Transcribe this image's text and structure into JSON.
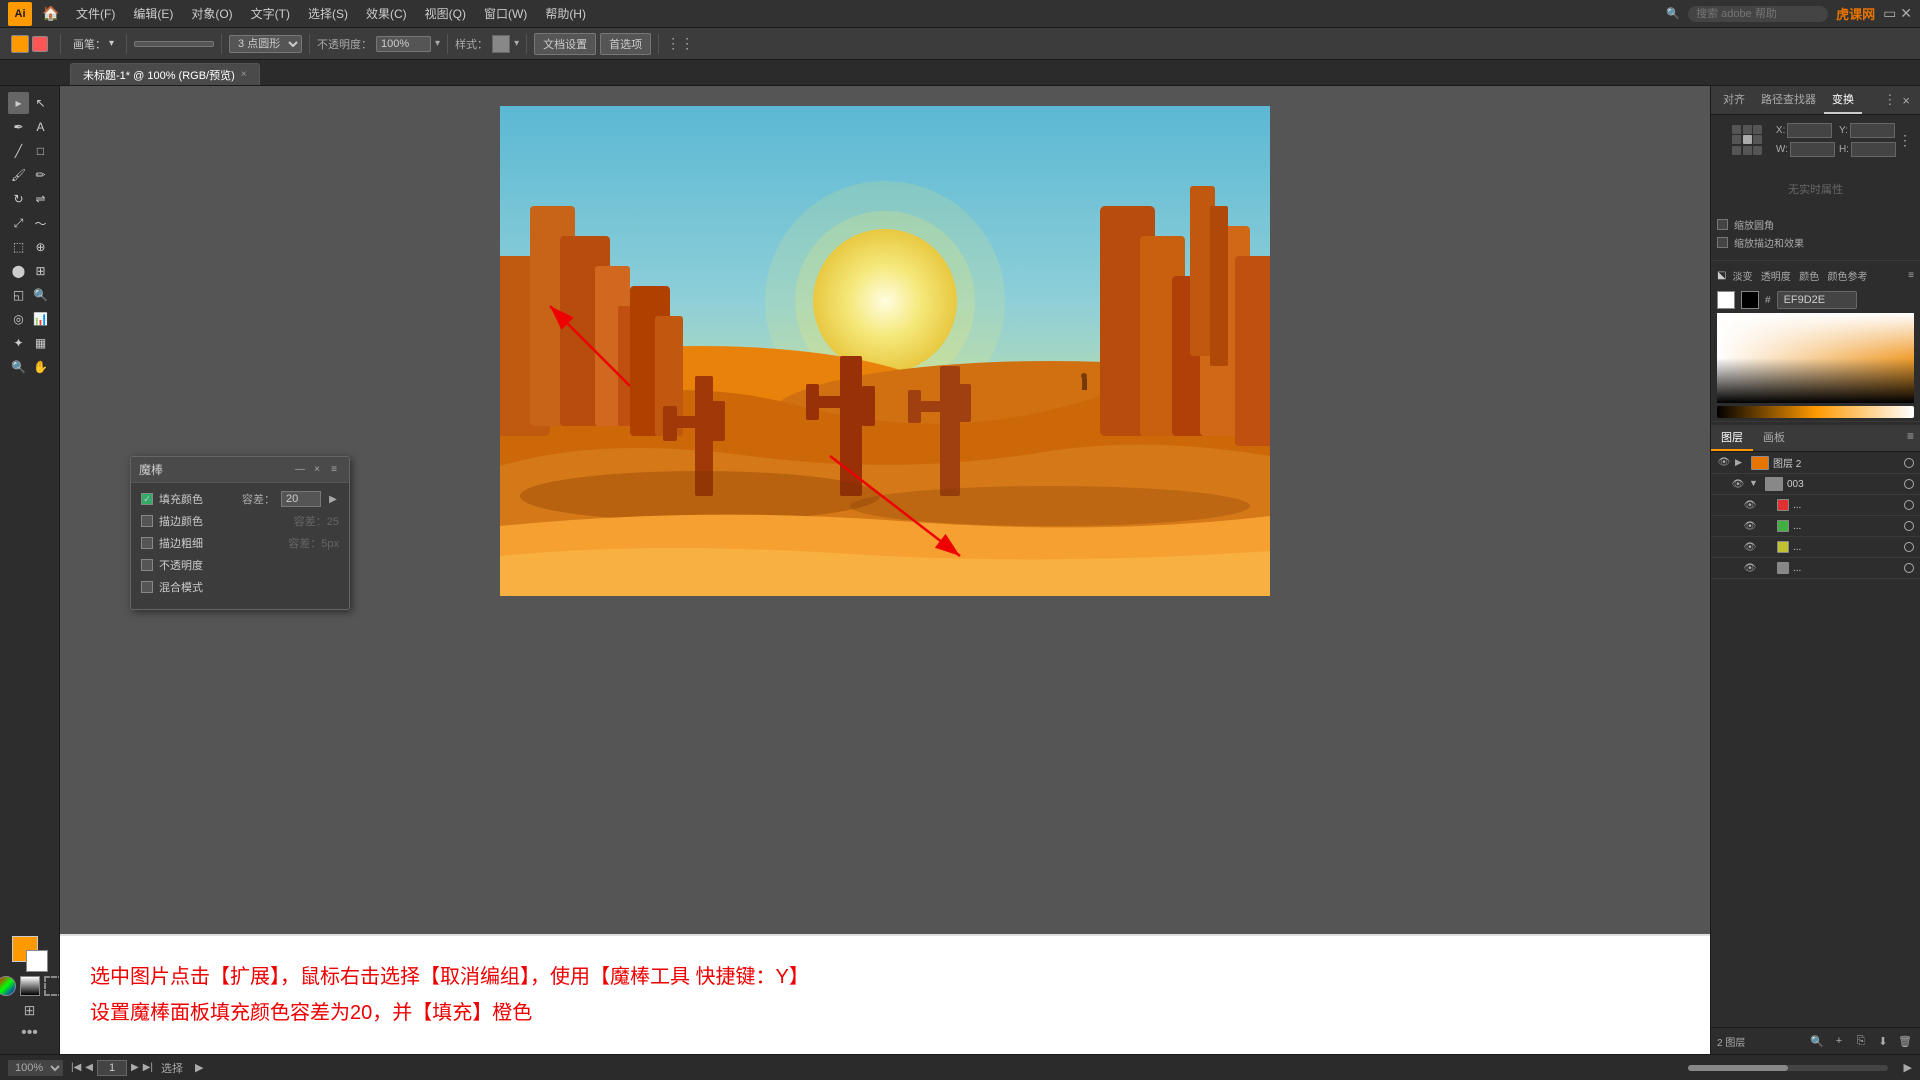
{
  "app": {
    "title": "Adobe Illustrator",
    "logo": "Ai"
  },
  "menu": {
    "items": [
      "文件(F)",
      "编辑(E)",
      "对象(O)",
      "文字(T)",
      "选择(S)",
      "效果(C)",
      "视图(Q)",
      "窗口(W)",
      "帮助(H)"
    ],
    "search_placeholder": "搜索 adobe 帮助",
    "watermark": "虎课网"
  },
  "toolbar": {
    "stroke_label": "描边：",
    "brush_label": "画笔：",
    "point_label": "3 点圆形",
    "opacity_label": "不透明度：",
    "opacity_value": "100%",
    "style_label": "样式：",
    "doc_settings": "文档设置",
    "preferences": "首选项"
  },
  "tab": {
    "title": "未标题-1* @ 100% (RGB/预览)",
    "close": "×"
  },
  "magic_panel": {
    "title": "魔棒",
    "options": [
      {
        "label": "填充颜色",
        "checked": true,
        "has_value": true,
        "value": "20"
      },
      {
        "label": "描边颜色",
        "checked": false,
        "has_value": false,
        "value": "容差：25"
      },
      {
        "label": "描边粗细",
        "checked": false,
        "has_value": false,
        "value": "容差：5px"
      },
      {
        "label": "不透明度",
        "checked": false,
        "has_value": false,
        "value": ""
      },
      {
        "label": "混合模式",
        "checked": false,
        "has_value": false,
        "value": ""
      }
    ],
    "tolerance_label": "容差：",
    "tolerance_value": "20"
  },
  "instruction": {
    "line1": "选中图片点击【扩展】，鼠标右击选择【取消编组】，使用【魔棒工具 快捷键：Y】",
    "line2": "设置魔棒面板填充颜色容差为20，并【填充】橙色"
  },
  "right_panel": {
    "tabs": [
      "对齐",
      "路径查找器",
      "变换"
    ],
    "active_tab": "变换",
    "no_attr": "无实时属性",
    "checkboxes": [
      "缩放圆角",
      "缩放描边和效果"
    ],
    "rows": [
      {
        "label": "淡变",
        "value": ""
      },
      {
        "label": "透明度",
        "value": ""
      },
      {
        "label": "颜色",
        "value": ""
      },
      {
        "label": "颜色参考",
        "value": ""
      }
    ],
    "hex_value": "EF9D2E"
  },
  "layers_panel": {
    "tabs": [
      "图层",
      "画板"
    ],
    "active_tab": "图层",
    "layers": [
      {
        "name": "图层 2",
        "level": 0,
        "expanded": true,
        "has_eye": true,
        "has_expand": true
      },
      {
        "name": "003",
        "level": 1,
        "expanded": false,
        "has_eye": true
      },
      {
        "name": "...",
        "level": 2,
        "color": "#e03030"
      },
      {
        "name": "...",
        "level": 2,
        "color": "#40b040"
      },
      {
        "name": "...",
        "level": 2,
        "color": "#c0c030"
      },
      {
        "name": "...",
        "level": 2,
        "color": "#888888"
      }
    ],
    "layer_count": "2 图层"
  },
  "status_bar": {
    "zoom": "100%",
    "page": "1",
    "mode": "选择"
  },
  "colors": {
    "accent_orange": "#f90000",
    "canvas_bg": "#555555",
    "panel_bg": "#2d2d2d",
    "artboard_bg": "#ffffff"
  }
}
